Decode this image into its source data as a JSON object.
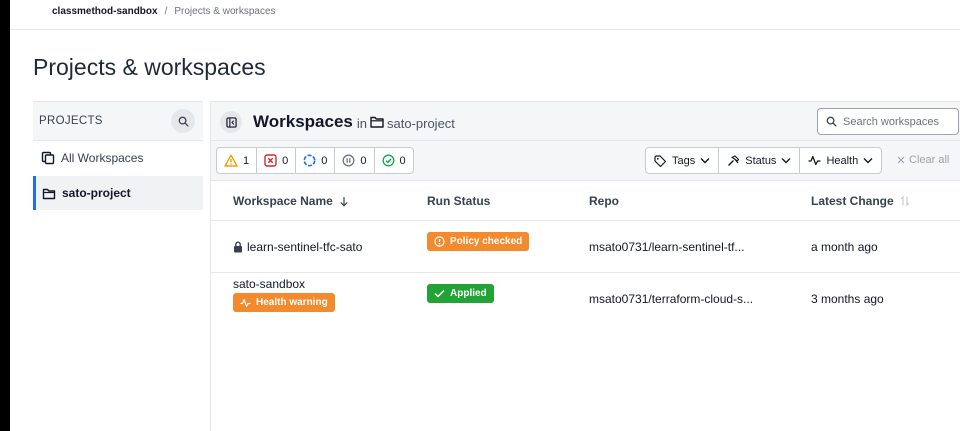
{
  "breadcrumb": {
    "org": "classmethod-sandbox",
    "separator": "/",
    "page": "Projects & workspaces"
  },
  "page_title": "Projects & workspaces",
  "sidebar": {
    "header": "PROJECTS",
    "items": [
      {
        "label": "All Workspaces",
        "icon": "workspaces-icon"
      },
      {
        "label": "sato-project",
        "icon": "folder-icon",
        "active": true
      }
    ]
  },
  "main": {
    "title": "Workspaces",
    "in_text": "in",
    "project": "sato-project",
    "search_placeholder": "Search workspaces"
  },
  "status_filters": [
    {
      "icon": "warning-icon",
      "count": "1",
      "color": "#f59e0b"
    },
    {
      "icon": "error-icon",
      "count": "0",
      "color": "#dc2626"
    },
    {
      "icon": "running-icon",
      "count": "0",
      "color": "#1e6ef5"
    },
    {
      "icon": "paused-icon",
      "count": "0",
      "color": "#6b7280"
    },
    {
      "icon": "check-icon",
      "count": "0",
      "color": "#16a34a"
    }
  ],
  "filter_dropdowns": {
    "tags": "Tags",
    "status": "Status",
    "health": "Health"
  },
  "clear_all": "Clear all",
  "table": {
    "columns": {
      "name": "Workspace Name",
      "run_status": "Run Status",
      "repo": "Repo",
      "latest_change": "Latest Change"
    },
    "rows": [
      {
        "name": "learn-sentinel-tfc-sato",
        "locked": true,
        "run_status": "Policy checked",
        "run_status_color": "#f38a2e",
        "repo": "msato0731/learn-sentinel-tf...",
        "latest_change": "a month ago"
      },
      {
        "name": "sato-sandbox",
        "health": "Health warning",
        "run_status": "Applied",
        "run_status_color": "#21a336",
        "repo": "msato0731/terraform-cloud-s...",
        "latest_change": "3 months ago"
      }
    ]
  },
  "colors": {
    "accent": "#1e6ef5",
    "orange": "#f38a2e",
    "green": "#21a336"
  }
}
